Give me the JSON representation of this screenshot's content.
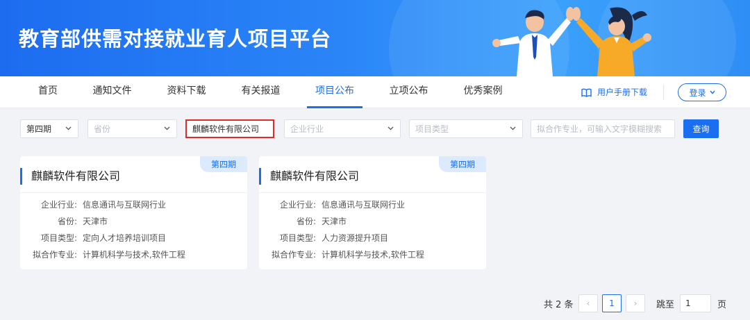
{
  "banner": {
    "title": "教育部供需对接就业育人项目平台"
  },
  "nav": {
    "items": [
      {
        "label": "首页"
      },
      {
        "label": "通知文件"
      },
      {
        "label": "资料下载"
      },
      {
        "label": "有关报道"
      },
      {
        "label": "项目公布"
      },
      {
        "label": "立项公布"
      },
      {
        "label": "优秀案例"
      }
    ],
    "active": "项目公布",
    "manual_label": "用户手册下载",
    "login_label": "登录"
  },
  "filters": {
    "period": {
      "value": "第四期"
    },
    "province": {
      "placeholder": "省份"
    },
    "company": {
      "value": "麒麟软件有限公司"
    },
    "industry": {
      "placeholder": "企业行业"
    },
    "project_type": {
      "placeholder": "项目类型"
    },
    "major": {
      "placeholder": "拟合作专业，可输入文字模糊搜索"
    },
    "search_label": "查询"
  },
  "cards": [
    {
      "tag": "第四期",
      "company": "麒麟软件有限公司",
      "rows": [
        {
          "label": "企业行业:",
          "value": "信息通讯与互联网行业"
        },
        {
          "label": "省份:",
          "value": "天津市"
        },
        {
          "label": "项目类型:",
          "value": "定向人才培养培训项目"
        },
        {
          "label": "拟合作专业:",
          "value": "计算机科学与技术,软件工程"
        }
      ]
    },
    {
      "tag": "第四期",
      "company": "麒麟软件有限公司",
      "rows": [
        {
          "label": "企业行业:",
          "value": "信息通讯与互联网行业"
        },
        {
          "label": "省份:",
          "value": "天津市"
        },
        {
          "label": "项目类型:",
          "value": "人力资源提升项目"
        },
        {
          "label": "拟合作专业:",
          "value": "计算机科学与技术,软件工程"
        }
      ]
    }
  ],
  "pagination": {
    "total_label": "共 2 条",
    "current_page": "1",
    "prev_symbol": "‹",
    "next_symbol": "›",
    "jump_label": "跳至",
    "jump_value": "1",
    "page_unit": "页"
  },
  "colors": {
    "primary": "#1b6ef0",
    "highlight": "#e02a2a",
    "background": "#f1f3f7"
  }
}
